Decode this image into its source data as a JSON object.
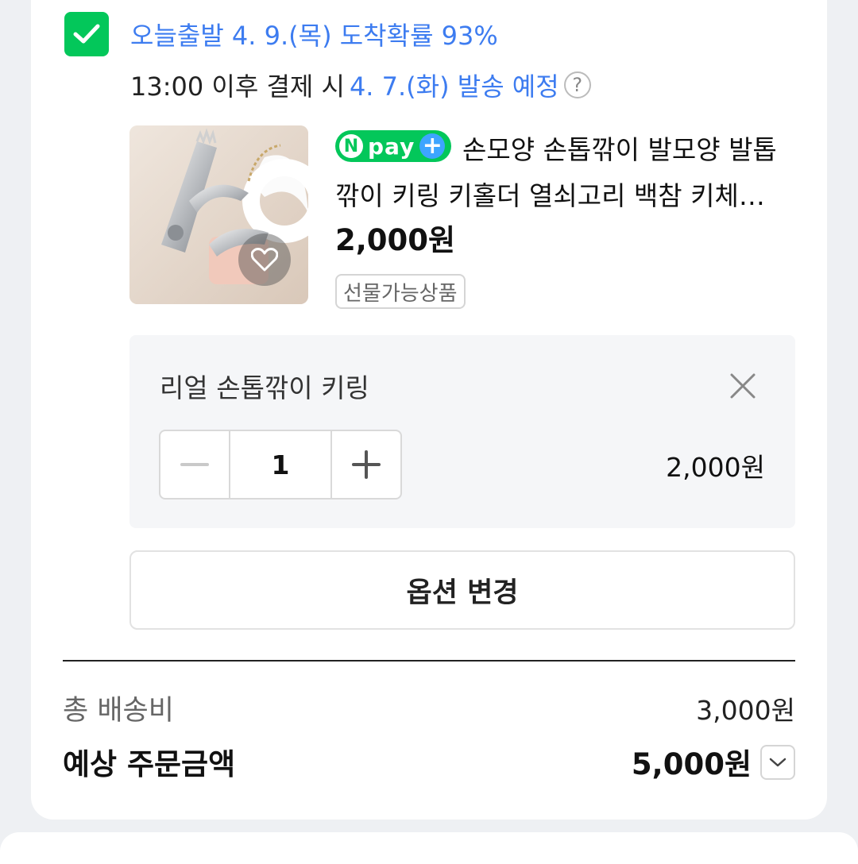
{
  "delivery": {
    "arrival": "오늘출발 4. 9.(목) 도착확률 93%",
    "cutoff_prefix": "13:00 이후 결제 시",
    "ship_date": "4. 7.(화) 발송 예정",
    "help_symbol": "?"
  },
  "product": {
    "npay_n": "N",
    "npay_label": "pay",
    "npay_plus": "+",
    "title": "손모양 손톱깎이 발모양 발톱깎이 키링 키홀더 열쇠고리 백참 키체인 선물",
    "price": "2,000원",
    "badge": "선물가능상품",
    "image_icon": "heart-icon"
  },
  "option": {
    "name": "리얼 손톱깎이 키링",
    "quantity": "1",
    "price": "2,000원"
  },
  "buttons": {
    "change_option": "옵션 변경"
  },
  "summary": {
    "shipping_label": "총 배송비",
    "shipping_value": "3,000원",
    "total_label": "예상 주문금액",
    "total_value": "5,000원"
  },
  "colors": {
    "accent_green": "#03c75a",
    "link_blue": "#3d7cf0"
  }
}
